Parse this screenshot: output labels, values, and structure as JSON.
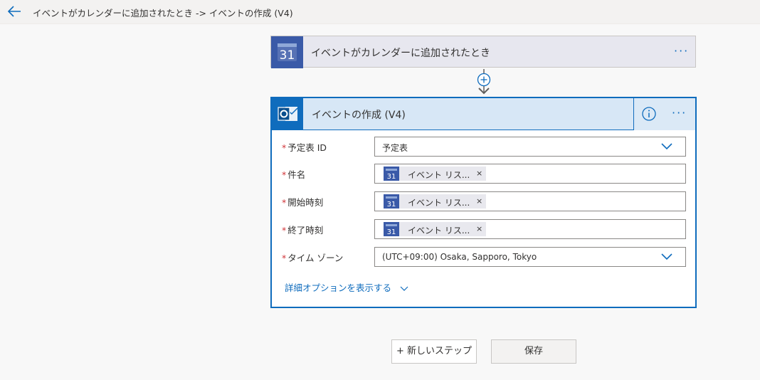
{
  "header": {
    "breadcrumb": "イベントがカレンダーに追加されたとき -> イベントの作成 (V4)"
  },
  "trigger": {
    "title": "イベントがカレンダーに追加されたとき",
    "icon_day": "31",
    "more_label": "···"
  },
  "action": {
    "title": "イベントの作成 (V4)",
    "more_label": "···",
    "fields": [
      {
        "label": "予定表 ID",
        "value": "予定表"
      },
      {
        "label": "件名",
        "token": "イベント リス...",
        "token_icon_day": "31"
      },
      {
        "label": "開始時刻",
        "token": "イベント リス...",
        "token_icon_day": "31"
      },
      {
        "label": "終了時刻",
        "token": "イベント リス...",
        "token_icon_day": "31"
      },
      {
        "label": "タイム ゾーン",
        "value": "(UTC+09:00) Osaka, Sapporo, Tokyo"
      }
    ],
    "required_mark": "*",
    "token_remove": "×",
    "advanced_options": "詳細オプションを表示する"
  },
  "footer": {
    "new_step": "+ 新しいステップ",
    "save": "保存"
  },
  "colors": {
    "accent": "#0f6cbd",
    "calendar_blue": "#3a5aa8",
    "required": "#d13438"
  }
}
